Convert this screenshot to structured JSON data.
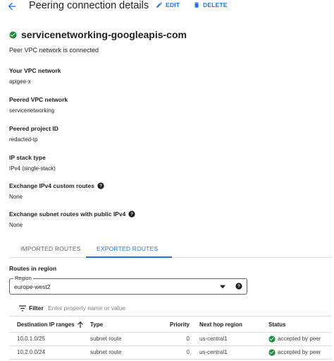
{
  "header": {
    "back_icon": "arrow-back-icon",
    "title": "Peering connection details",
    "edit_label": "EDIT",
    "delete_label": "DELETE"
  },
  "connection": {
    "name": "servicenetworking-googleapis-com",
    "status_icon": "check-circle-icon",
    "status_text": "Peer VPC network is connected"
  },
  "fields": [
    {
      "label": "Your VPC network",
      "value": "apigee-x",
      "help": false
    },
    {
      "label": "Peered VPC network",
      "value": "servicenetworking",
      "help": false
    },
    {
      "label": "Peered project ID",
      "value": "redacted-tp",
      "help": false
    },
    {
      "label": "IP stack type",
      "value": "IPv4 (single-stack)",
      "help": false
    },
    {
      "label": "Exchange IPv4 custom routes",
      "value": "None",
      "help": true
    },
    {
      "label": "Exchange subnet routes with public IPv4",
      "value": "None",
      "help": true
    }
  ],
  "tabs": [
    {
      "label": "IMPORTED ROUTES",
      "active": false
    },
    {
      "label": "EXPORTED ROUTES",
      "active": true
    }
  ],
  "routes": {
    "heading": "Routes in region",
    "region_label": "Region",
    "region_value": "europe-west2",
    "filter_label": "Filter",
    "filter_placeholder": "Enter property name or value",
    "columns": [
      "Destination IP ranges",
      "Type",
      "Priority",
      "Next hop region",
      "Status"
    ],
    "rows": [
      [
        "10.0.1.0/25",
        "subnet route",
        "0",
        "us-central1",
        "accepted by peer"
      ],
      [
        "10.2.0.0/24",
        "subnet route",
        "0",
        "us-central1",
        "accepted by peer"
      ]
    ]
  },
  "colors": {
    "accent": "#1a73e8",
    "success": "#1e8e3e",
    "text": "#202124"
  }
}
